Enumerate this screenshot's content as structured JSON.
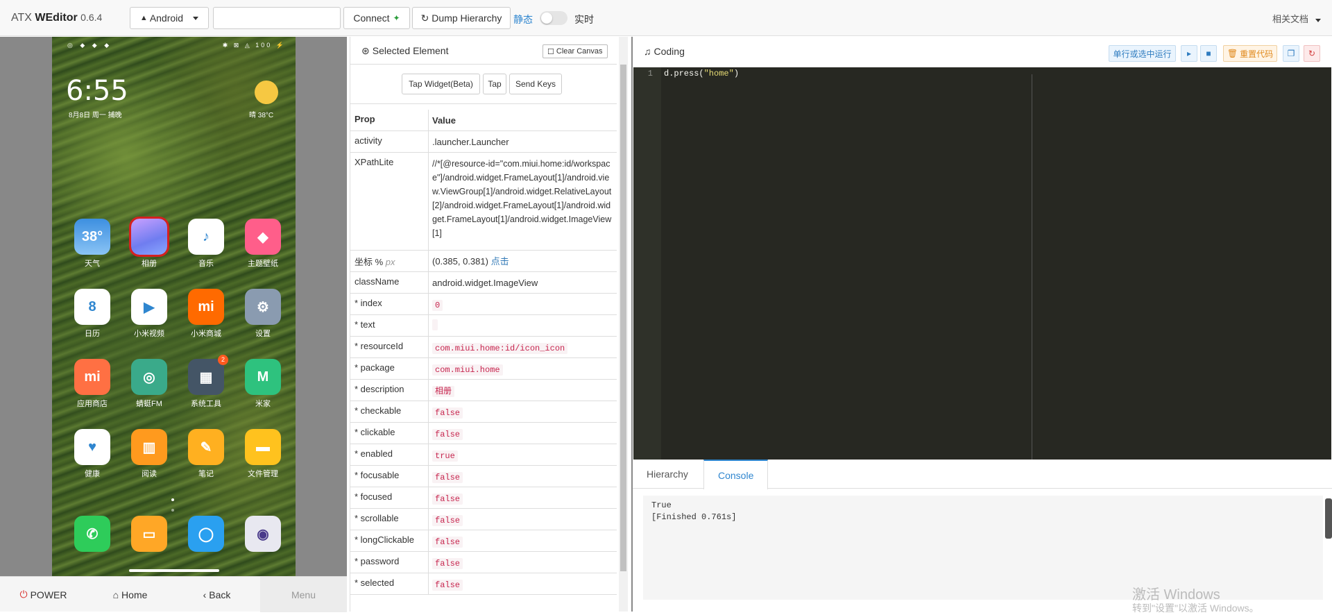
{
  "navbar": {
    "brand_prefix": "ATX",
    "brand_name": "WEditor",
    "version": "0.6.4",
    "platform_select": "Android",
    "device_input": "",
    "connect_label": "Connect",
    "dump_label": "Dump Hierarchy",
    "static_label": "静态",
    "realtime_label": "实时",
    "docs_label": "相关文档"
  },
  "phone": {
    "status_left": "◎ ◆ ◆ ◆",
    "status_right": "✱ ⊠ ◬ 100 ⚡",
    "time": "6:55",
    "date": "8月8日 周一 捕晚",
    "weather_temp": "晴 38°C",
    "apps": [
      {
        "label": "天气",
        "icon": "38°",
        "color": "#4aa3e8",
        "icon_name": "weather-app-icon"
      },
      {
        "label": "相册",
        "icon": "",
        "color": "#8a7fe8",
        "icon_name": "gallery-app-icon"
      },
      {
        "label": "音乐",
        "icon": "♪",
        "color": "#ffffff",
        "icon_name": "music-app-icon"
      },
      {
        "label": "主题壁纸",
        "icon": "◆",
        "color": "#ff5e8a",
        "icon_name": "themes-app-icon"
      },
      {
        "label": "日历",
        "icon": "8",
        "color": "#ffffff",
        "icon_name": "calendar-app-icon"
      },
      {
        "label": "小米视频",
        "icon": "▶",
        "color": "#ffffff",
        "icon_name": "video-app-icon"
      },
      {
        "label": "小米商城",
        "icon": "mi",
        "color": "#ff6a00",
        "icon_name": "mi-store-app-icon"
      },
      {
        "label": "设置",
        "icon": "⚙",
        "color": "#8a9bb0",
        "icon_name": "settings-app-icon"
      },
      {
        "label": "应用商店",
        "icon": "mi",
        "color": "#ff7043",
        "icon_name": "app-store-icon"
      },
      {
        "label": "蜻蜓FM",
        "icon": "◎",
        "color": "#3aaa8a",
        "icon_name": "fm-app-icon"
      },
      {
        "label": "系统工具",
        "icon": "▦",
        "color": "#445566",
        "icon_name": "tools-folder-icon"
      },
      {
        "label": "米家",
        "icon": "M",
        "color": "#2ec27e",
        "icon_name": "mijia-app-icon"
      },
      {
        "label": "健康",
        "icon": "♥",
        "color": "#ffffff",
        "icon_name": "health-app-icon"
      },
      {
        "label": "阅读",
        "icon": "▥",
        "color": "#ff9a1e",
        "icon_name": "reader-app-icon"
      },
      {
        "label": "笔记",
        "icon": "✎",
        "color": "#ffb020",
        "icon_name": "notes-app-icon"
      },
      {
        "label": "文件管理",
        "icon": "▬",
        "color": "#ffc21e",
        "icon_name": "files-app-icon"
      }
    ],
    "badge": "2",
    "dock": [
      {
        "icon": "✆",
        "color": "#2ecc5a",
        "icon_name": "phone-app-icon"
      },
      {
        "icon": "▭",
        "color": "#ffa726",
        "icon_name": "messages-app-icon"
      },
      {
        "icon": "◯",
        "color": "#2aa0f0",
        "icon_name": "browser-app-icon"
      },
      {
        "icon": "◉",
        "color": "#e8e8f0",
        "icon_name": "camera-app-icon"
      }
    ]
  },
  "phone_buttons": {
    "power": "POWER",
    "home": "Home",
    "back": "Back",
    "menu": "Menu"
  },
  "inspector": {
    "title": "Selected Element",
    "clear_canvas": "Clear Canvas",
    "tap_widget": "Tap Widget(Beta)",
    "tap": "Tap",
    "send_keys": "Send Keys",
    "header_prop": "Prop",
    "header_value": "Value",
    "rows": {
      "activity": {
        "k": "activity",
        "v": ".launcher.Launcher"
      },
      "xpath": {
        "k": "XPathLite",
        "v": "//*[@resource-id=\"com.miui.home:id/workspace\"]/android.widget.FrameLayout[1]/android.view.ViewGroup[1]/android.widget.RelativeLayout[2]/android.widget.FrameLayout[1]/android.widget.FrameLayout[1]/android.widget.ImageView[1]"
      },
      "coord": {
        "k": "坐标 %",
        "unit": "px",
        "v": "(0.385, 0.381)",
        "link": "点击"
      },
      "classname": {
        "k": "className",
        "v": "android.widget.ImageView"
      },
      "index": {
        "k": "* index",
        "v": "0"
      },
      "text": {
        "k": "* text",
        "v": ""
      },
      "resourceid": {
        "k": "* resourceId",
        "v": "com.miui.home:id/icon_icon"
      },
      "package": {
        "k": "* package",
        "v": "com.miui.home"
      },
      "description": {
        "k": "* description",
        "v": "相册"
      },
      "checkable": {
        "k": "* checkable",
        "v": "false"
      },
      "clickable": {
        "k": "* clickable",
        "v": "false"
      },
      "enabled": {
        "k": "* enabled",
        "v": "true"
      },
      "focusable": {
        "k": "* focusable",
        "v": "false"
      },
      "focused": {
        "k": "* focused",
        "v": "false"
      },
      "scrollable": {
        "k": "* scrollable",
        "v": "false"
      },
      "longclickable": {
        "k": "* longClickable",
        "v": "false"
      },
      "password": {
        "k": "* password",
        "v": "false"
      },
      "selected": {
        "k": "* selected",
        "v": "false"
      }
    }
  },
  "coding": {
    "title": "Coding",
    "run_label": "单行或选中运行",
    "reset_label": "重置代码",
    "line_number": "1",
    "code_prefix": "d.press(",
    "code_string": "\"home\"",
    "code_suffix": ")",
    "tab_hierarchy": "Hierarchy",
    "tab_console": "Console",
    "console_lines": [
      "True",
      "[Finished 0.761s]"
    ]
  },
  "watermark": {
    "line1": "激活 Windows",
    "line2": "转到\"设置\"以激活 Windows。"
  }
}
